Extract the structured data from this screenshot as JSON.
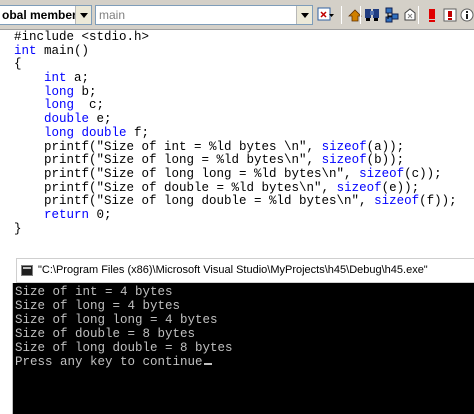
{
  "toolbar": {
    "scope_combo": "obal members",
    "member_combo": "main",
    "icons": [
      "wizard-dropdown-icon",
      "go-definition-icon",
      "find-icon",
      "class-view-icon",
      "error-red-icon",
      "warning-icon",
      "info-icon",
      "bookmark-icon"
    ]
  },
  "editor": {
    "lines": [
      [
        {
          "t": "#include <stdio.h>",
          "k": 0
        }
      ],
      [
        {
          "t": "int",
          "k": 1
        },
        {
          "t": " main()",
          "k": 0
        }
      ],
      [
        {
          "t": "{",
          "k": 0
        }
      ],
      [
        {
          "t": "    ",
          "k": 0
        },
        {
          "t": "int",
          "k": 1
        },
        {
          "t": " a;",
          "k": 0
        }
      ],
      [
        {
          "t": "    ",
          "k": 0
        },
        {
          "t": "long",
          "k": 1
        },
        {
          "t": " b;",
          "k": 0
        }
      ],
      [
        {
          "t": "    ",
          "k": 0
        },
        {
          "t": "long",
          "k": 1
        },
        {
          "t": "  c;",
          "k": 0
        }
      ],
      [
        {
          "t": "    ",
          "k": 0
        },
        {
          "t": "double",
          "k": 1
        },
        {
          "t": " e;",
          "k": 0
        }
      ],
      [
        {
          "t": "    ",
          "k": 0
        },
        {
          "t": "long double",
          "k": 1
        },
        {
          "t": " f;",
          "k": 0
        }
      ],
      [
        {
          "t": "    printf(\"Size of int = %ld bytes \\n\", ",
          "k": 0
        },
        {
          "t": "sizeof",
          "k": 1
        },
        {
          "t": "(a));",
          "k": 0
        }
      ],
      [
        {
          "t": "    printf(\"Size of long = %ld bytes\\n\", ",
          "k": 0
        },
        {
          "t": "sizeof",
          "k": 1
        },
        {
          "t": "(b));",
          "k": 0
        }
      ],
      [
        {
          "t": "    printf(\"Size of long long = %ld bytes\\n\", ",
          "k": 0
        },
        {
          "t": "sizeof",
          "k": 1
        },
        {
          "t": "(c));",
          "k": 0
        }
      ],
      [
        {
          "t": "    printf(\"Size of double = %ld bytes\\n\", ",
          "k": 0
        },
        {
          "t": "sizeof",
          "k": 1
        },
        {
          "t": "(e));",
          "k": 0
        }
      ],
      [
        {
          "t": "    printf(\"Size of long double = %ld bytes\\n\", ",
          "k": 0
        },
        {
          "t": "sizeof",
          "k": 1
        },
        {
          "t": "(f));",
          "k": 0
        }
      ],
      [
        {
          "t": "    ",
          "k": 0
        },
        {
          "t": "return",
          "k": 1
        },
        {
          "t": " 0;",
          "k": 0
        }
      ],
      [
        {
          "t": "}",
          "k": 0
        }
      ]
    ]
  },
  "console": {
    "title": "\"C:\\Program Files (x86)\\Microsoft Visual Studio\\MyProjects\\h45\\Debug\\h45.exe\"",
    "output": [
      "Size of int = 4 bytes",
      "Size of long = 4 bytes",
      "Size of long long = 4 bytes",
      "Size of double = 8 bytes",
      "Size of long double = 8 bytes",
      "Press any key to continue"
    ]
  },
  "colors": {
    "keyword": "#0000ff",
    "console_bg": "#000000",
    "console_fg": "#c0c0c0",
    "toolbar_bg": "#d4d0c8"
  }
}
